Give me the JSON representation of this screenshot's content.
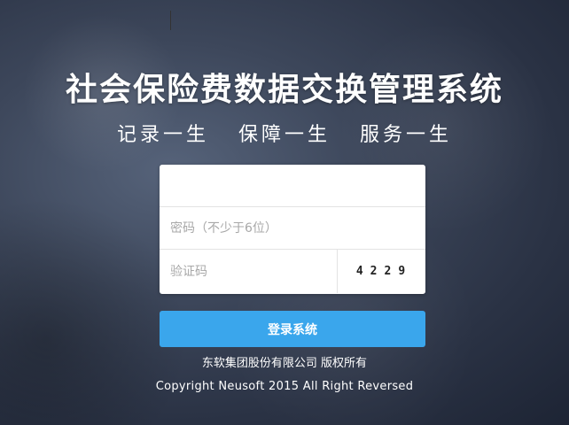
{
  "header": {
    "title": "社会保险费数据交换管理系统",
    "slogan": "记录一生   保障一生   服务一生"
  },
  "login_form": {
    "username": {
      "value": "",
      "placeholder": ""
    },
    "password": {
      "value": "",
      "placeholder": "密码（不少于6位）"
    },
    "captcha": {
      "value": "",
      "placeholder": "验证码",
      "code": "4229"
    },
    "submit_label": "登录系统"
  },
  "footer": {
    "company": "东软集团股份有限公司 版权所有",
    "copyright": "Copyright Neusoft 2015 All Right Reversed"
  },
  "colors": {
    "button": "#3aa6ec",
    "text": "#ffffff"
  }
}
